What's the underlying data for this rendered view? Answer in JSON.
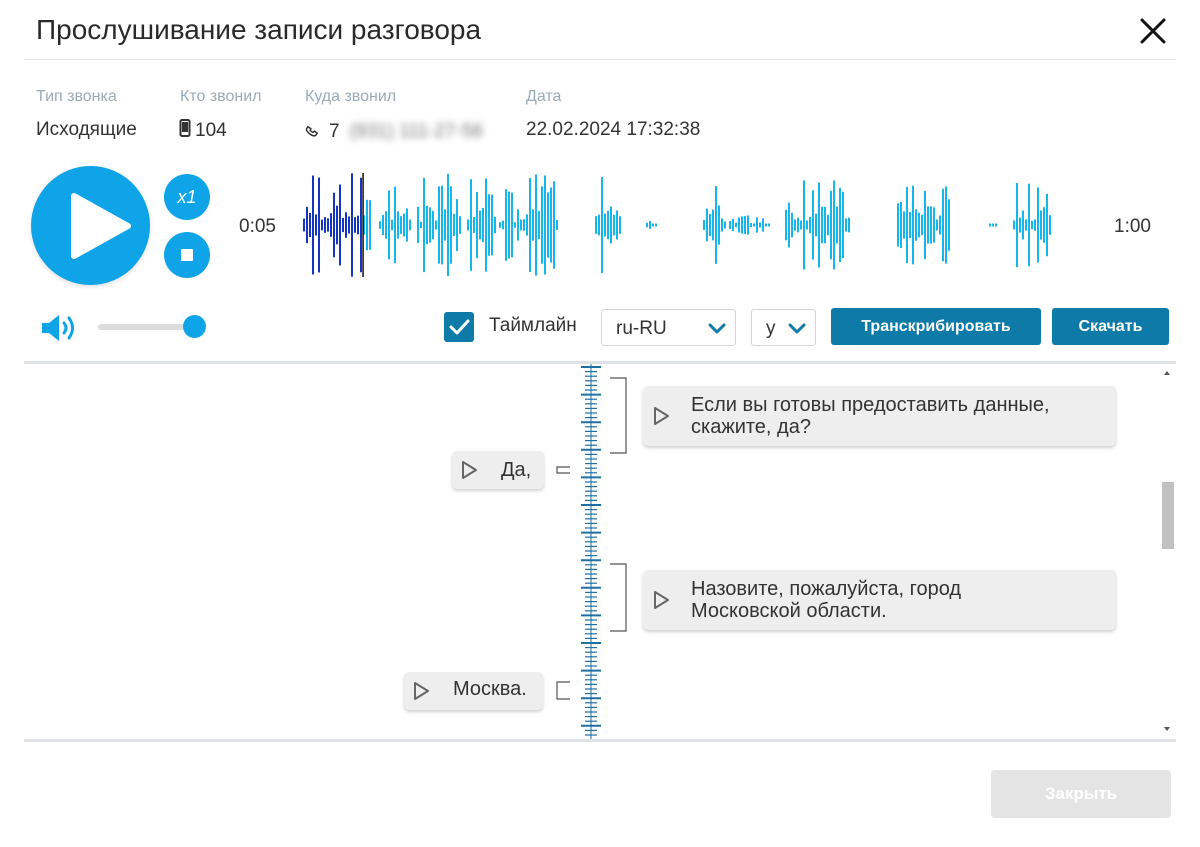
{
  "dialog": {
    "title": "Прослушивание записи разговора"
  },
  "call_info": {
    "type": {
      "label": "Тип звонка",
      "value": "Исходящие"
    },
    "caller": {
      "label": "Кто звонил",
      "value": "104",
      "icon": "mobile-phone-icon"
    },
    "callee": {
      "label": "Куда звонил",
      "value_prefix": "7",
      "value_blurred": "(931) 111-27-56",
      "icon": "phone-handset-icon"
    },
    "date": {
      "label": "Дата",
      "value": "22.02.2024 17:32:38"
    }
  },
  "player": {
    "current_time": "0:05",
    "total_time": "1:00",
    "played_fraction": 0.083,
    "speed_label": "x1",
    "volume_fraction": 1.0,
    "colors": {
      "accent": "#0fa4e8",
      "played": "#1534c4",
      "unplayed": "#17b6ea",
      "button_dark": "#0d7aa8"
    }
  },
  "toolbar": {
    "timeline_label": "Таймлайн",
    "timeline_checked": true,
    "language_value": "ru-RU",
    "mode_value": "у",
    "transcribe_label": "Транскрибировать",
    "download_label": "Скачать"
  },
  "transcript": {
    "messages": [
      {
        "speaker": "right",
        "line1": "Если вы готовы предоставить данные,",
        "line2": "скажите, да?"
      },
      {
        "speaker": "left",
        "text": "Да,"
      },
      {
        "speaker": "right",
        "line1": "Назовите, пожалуйста, город",
        "line2": "Московской области."
      },
      {
        "speaker": "left",
        "text": "Москва."
      }
    ]
  },
  "footer": {
    "close_label": "Закрыть"
  }
}
